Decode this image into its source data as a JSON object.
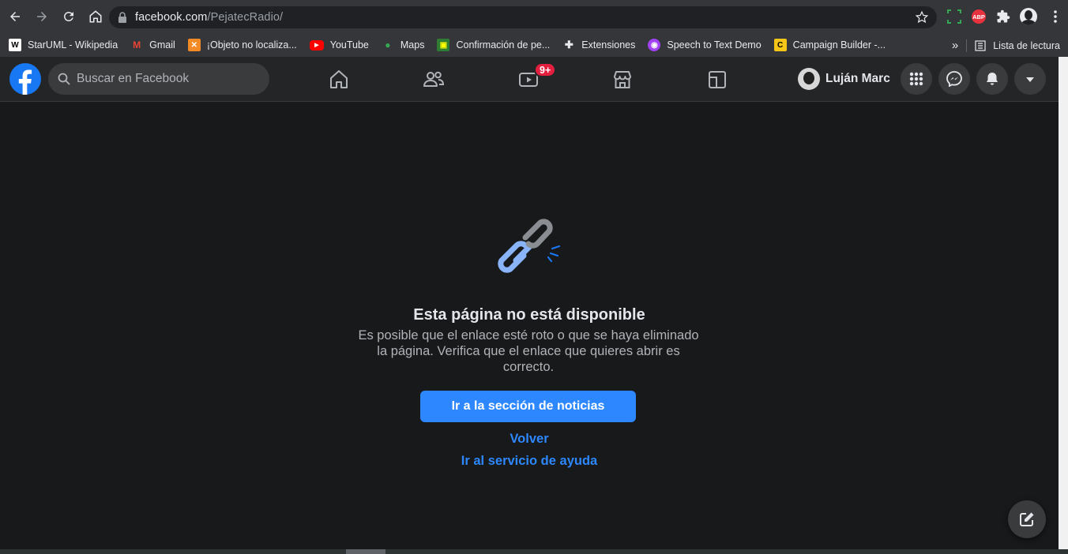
{
  "browser": {
    "url_host": "facebook.com",
    "url_path": "/PejatecRadio/",
    "extensions": [
      "grid-extension-icon",
      "adblock-plus-icon",
      "puzzle-icon",
      "profile-icon",
      "kebab-menu-icon"
    ],
    "adblock_label": "ABP"
  },
  "bookmarks": {
    "items": [
      {
        "label": "StarUML - Wikipedia",
        "fav": "W",
        "color": "#ffffff",
        "text_color": "#000000"
      },
      {
        "label": "Gmail",
        "fav": "M",
        "color": "#35363a",
        "text_color": "#ea4335"
      },
      {
        "label": "¡Objeto no localiza...",
        "fav": "✕",
        "color": "#f28b25",
        "text_color": "#ffffff"
      },
      {
        "label": "YouTube",
        "fav": "▶",
        "color": "#ff0000",
        "text_color": "#ffffff"
      },
      {
        "label": "Maps",
        "fav": "●",
        "color": "#35363a",
        "text_color": "#34a853"
      },
      {
        "label": "Confirmación de pe...",
        "fav": "▣",
        "color": "#2e7d32",
        "text_color": "#ffff00"
      },
      {
        "label": "Extensiones",
        "fav": "✚",
        "color": "#35363a",
        "text_color": "#e8eaed"
      },
      {
        "label": "Speech to Text Demo",
        "fav": "◉",
        "color": "#a142f4",
        "text_color": "#ffffff"
      },
      {
        "label": "Campaign Builder -...",
        "fav": "C",
        "color": "#f5c518",
        "text_color": "#000000"
      }
    ],
    "overflow": "»",
    "reading_list": "Lista de lectura"
  },
  "facebook": {
    "search_placeholder": "Buscar en Facebook",
    "watch_badge": "9+",
    "profile_name": "Luján Marc"
  },
  "error_page": {
    "title": "Esta página no está disponible",
    "description": "Es posible que el enlace esté roto o que se haya eliminado la página. Verifica que el enlace que quieres abrir es correcto.",
    "primary_button": "Ir a la sección de noticias",
    "back_link": "Volver",
    "help_link": "Ir al servicio de ayuda"
  },
  "colors": {
    "fb_blue": "#2d88ff",
    "header_bg": "#242526",
    "page_bg": "#18191a"
  }
}
